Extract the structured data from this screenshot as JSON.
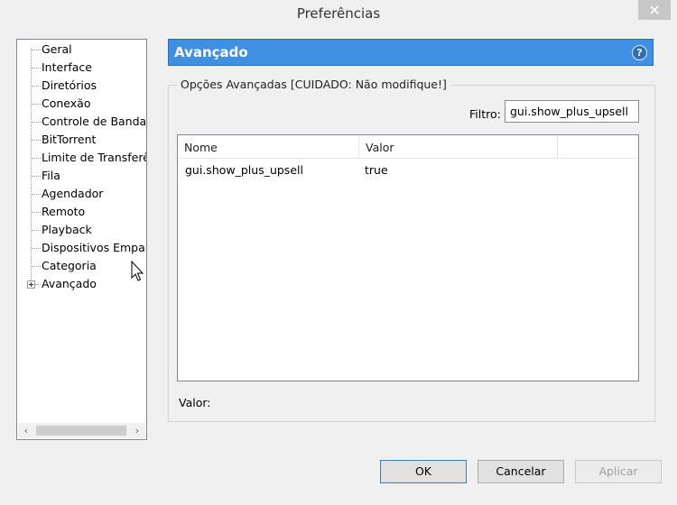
{
  "window": {
    "title": "Preferências"
  },
  "tree": {
    "items": [
      {
        "label": "Geral"
      },
      {
        "label": "Interface"
      },
      {
        "label": "Diretórios"
      },
      {
        "label": "Conexão"
      },
      {
        "label": "Controle de Banda"
      },
      {
        "label": "BitTorrent"
      },
      {
        "label": "Limite de Transferên"
      },
      {
        "label": "Fila"
      },
      {
        "label": "Agendador"
      },
      {
        "label": "Remoto"
      },
      {
        "label": "Playback"
      },
      {
        "label": "Dispositivos Empare"
      },
      {
        "label": "Categoria"
      },
      {
        "label": "Avançado"
      }
    ]
  },
  "panel": {
    "title": "Avançado",
    "help_icon": "?",
    "group_title": "Opções Avançadas [CUIDADO: Não modifique!]",
    "filter_label": "Filtro:",
    "filter_value": "gui.show_plus_upsell",
    "columns": [
      "Nome",
      "Valor"
    ],
    "rows": [
      {
        "name": "gui.show_plus_upsell",
        "value": "true"
      }
    ],
    "value_label": "Valor:"
  },
  "buttons": {
    "ok": "OK",
    "cancel": "Cancelar",
    "apply": "Aplicar"
  },
  "colors": {
    "header": "#3f8fe3",
    "window_bg": "#f0f0f0"
  }
}
